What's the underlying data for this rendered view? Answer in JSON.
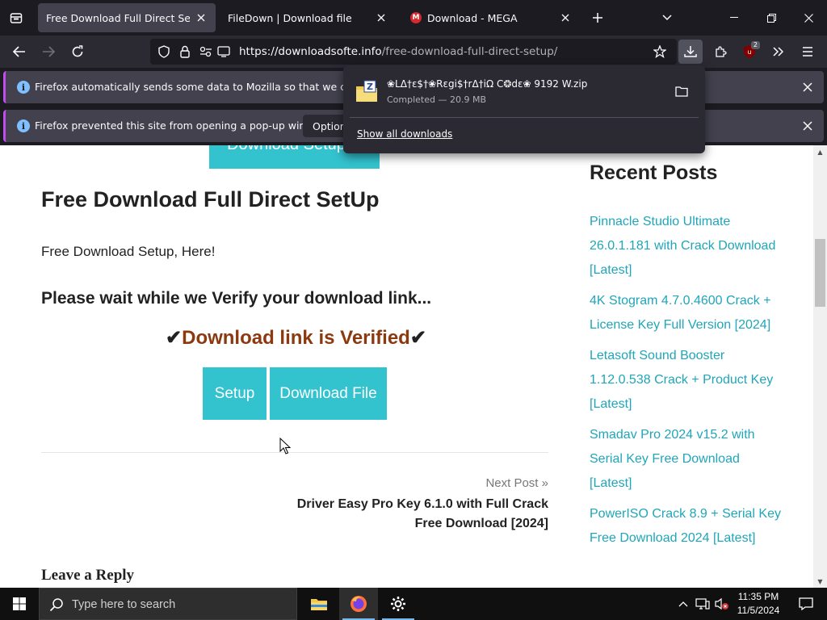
{
  "tabs": [
    {
      "label": "Free Download Full Direct SetUp - D",
      "active": true
    },
    {
      "label": "FileDown | Download file",
      "active": false
    },
    {
      "label": "Download - MEGA",
      "active": false,
      "favicon": "M"
    }
  ],
  "navbar": {
    "url_host": "https://downloadsofte.info",
    "url_path": "/free-download-full-direct-setup/",
    "extension_badge": "2"
  },
  "notifications": [
    {
      "text": "Firefox automatically sends some data to Mozilla so that we can improve"
    },
    {
      "text": "Firefox prevented this site from opening a pop-up window.",
      "button": "Options"
    }
  ],
  "downloads_panel": {
    "file_name": "❀LΔ†ε$†❀Rεgi$†rΔ†iΩ C❂dε❀ 9192 W.zip",
    "status": "Completed — 20.9 MB",
    "show_all": "Show all downloads"
  },
  "page": {
    "top_button": "Download Setup H",
    "title": "Free Download Full Direct SetUp",
    "intro": "Free Download Setup, Here!",
    "wait_text": "Please wait while we Verify your download link...",
    "verified_check": "✔",
    "verified_text": "Download link is Verified",
    "buttons": {
      "setup": "Setup",
      "download_file": "Download File"
    },
    "next_post_label": "Next Post »",
    "next_post_title": "Driver Easy Pro Key 6.1.0 with Full Crack Free Download [2024]",
    "leave_reply": "Leave a Reply"
  },
  "sidebar": {
    "title": "Recent Posts",
    "posts": [
      "Pinnacle Studio Ultimate 26.0.1.181 with Crack Download [Latest]",
      "4K Stogram 4.7.0.4600 Crack + License Key Full Version [2024]",
      "Letasoft Sound Booster 1.12.0.538 Crack + Product Key [Latest]",
      "Smadav Pro 2024 v15.2 with Serial Key Free Download [Latest]",
      "PowerISO Crack 8.9 + Serial Key Free Download 2024 [Latest]"
    ]
  },
  "taskbar": {
    "search_placeholder": "Type here to search",
    "time": "11:35 PM",
    "date": "11/5/2024"
  },
  "colors": {
    "accent_teal": "#33c3cf",
    "link_teal": "#1fa6b8",
    "verified_brown": "#8b3a0f",
    "notification_border": "#c14cf0"
  }
}
